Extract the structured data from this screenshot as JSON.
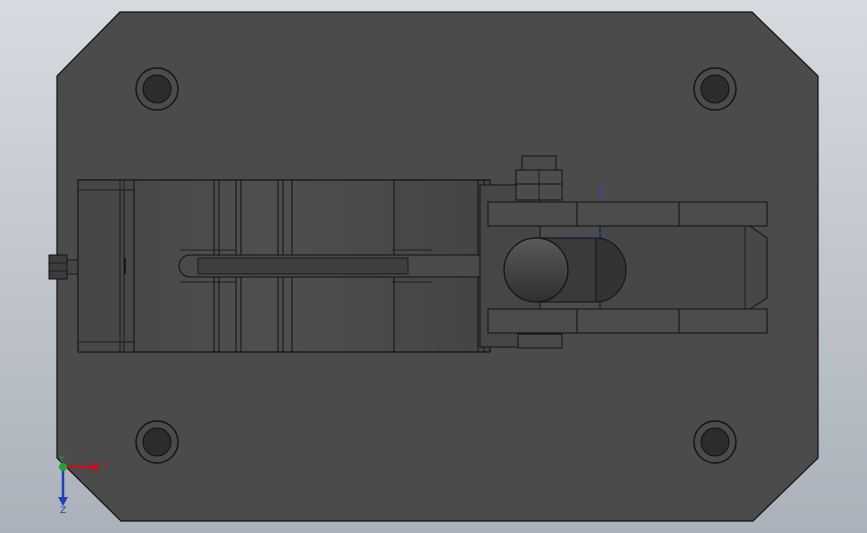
{
  "viewport": {
    "background_top": "#d7dbe0",
    "background_bottom": "#aab1ba"
  },
  "model": {
    "base_plate_color": "#4b4b4b",
    "edge_color": "#101010",
    "part_color": "#474747",
    "part_light": "#555555",
    "part_dark": "#3a3a3a",
    "hole_count": 4
  },
  "triad": {
    "x_label": "x",
    "y_label": "Y",
    "z_label": "Z",
    "x_color": "#c0121d",
    "y_color": "#21a33a",
    "z_color": "#1e3fb8"
  },
  "icons": {
    "triad": "coordinate-triad-icon",
    "pin_marker": "blue-pin-marker-icon"
  }
}
